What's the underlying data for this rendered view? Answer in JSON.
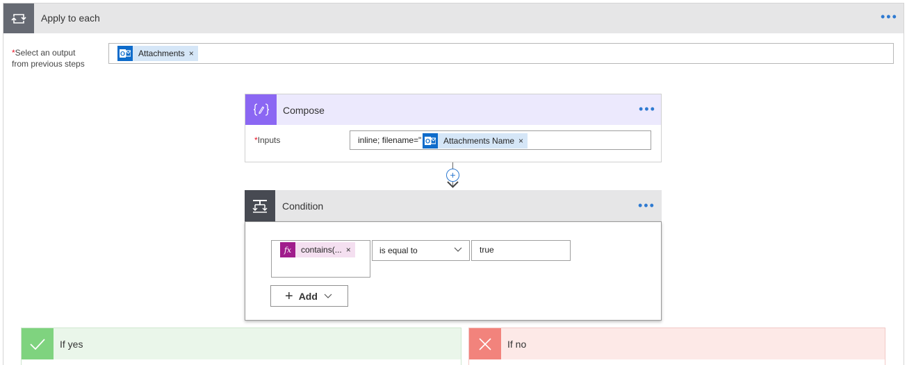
{
  "apply_to_each": {
    "title": "Apply to each",
    "more_label": "•••",
    "select_output_label_line1": "Select an output",
    "select_output_label_line2": "from previous steps",
    "required_mark": "*",
    "token_label": "Attachments",
    "token_remove": "×"
  },
  "compose": {
    "title": "Compose",
    "more_label": "•••",
    "required_mark": "*",
    "inputs_label": "Inputs",
    "inputs_prefix": "inline; filename=\"",
    "token_label": "Attachments Name",
    "token_remove": "×",
    "icon_glyph": "{ ⁄ }"
  },
  "connector": {
    "plus_label": "+"
  },
  "condition": {
    "title": "Condition",
    "more_label": "•••",
    "left_token_label": "contains(...",
    "left_token_icon": "fx",
    "left_token_remove": "×",
    "operator": "is equal to",
    "right_value": "true",
    "add_plus": "+",
    "add_label": "Add"
  },
  "branches": {
    "yes_label": "If yes",
    "no_label": "If no"
  },
  "colors": {
    "accent_blue": "#2e7ad1",
    "compose_purple": "#8b67f3",
    "condition_dark": "#474a52",
    "yes_green": "#7fd37f",
    "no_red": "#f2837c",
    "outlook_blue": "#0f6ccb",
    "expression_magenta": "#a01d8c"
  }
}
